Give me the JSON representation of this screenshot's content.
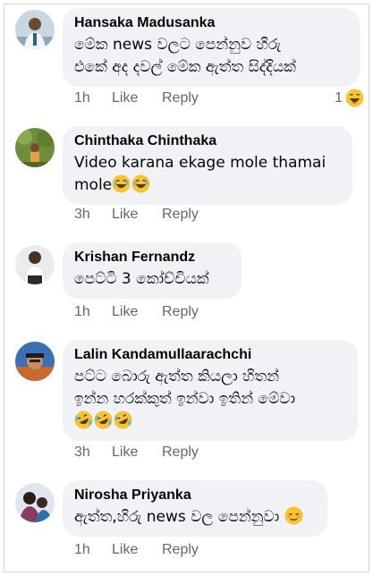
{
  "comments": [
    {
      "author": "Hansaka Madusanka",
      "text": "මේක news වලට පෙන්නුව හිරු\nඑකේ අද දවල් මේක ඇත්ත සිද්දියක්",
      "time": "1h",
      "like_label": "Like",
      "reply_label": "Reply",
      "reaction_count": "1",
      "reaction_icon": "laughing-emoji-icon"
    },
    {
      "author": "Chinthaka Chinthaka",
      "text": "Video karana ekage mole thamai\nmole",
      "emoji": [
        "laughing-emoji-icon",
        "laughing-emoji-icon"
      ],
      "time": "3h",
      "like_label": "Like",
      "reply_label": "Reply"
    },
    {
      "author": "Krishan Fernandz",
      "text": "පෙට්ටි 3 කෝච්චියක්",
      "time": "1h",
      "like_label": "Like",
      "reply_label": "Reply"
    },
    {
      "author": "Lalin Kandamullaarachchi",
      "text": "පට්ට බොරු ඇත්ත කියලා හිතන්\nඉන්න හරක්කුත් ඉන්වා ඉතින් මේවා",
      "emoji": [
        "rofl-emoji-icon",
        "rofl-emoji-icon",
        "rofl-emoji-icon"
      ],
      "time": "3h",
      "like_label": "Like",
      "reply_label": "Reply"
    },
    {
      "author": "Nirosha Priyanka",
      "text": "ඇත්ත,හිරු news වල පෙන්නුවා",
      "emoji": [
        "relieved-emoji-icon"
      ],
      "time": "1h",
      "like_label": "Like",
      "reply_label": "Reply"
    }
  ],
  "colors": {
    "bubble": "#f0f2f5",
    "meta_text": "#65676b",
    "emoji_yellow": "#f7c42f"
  }
}
